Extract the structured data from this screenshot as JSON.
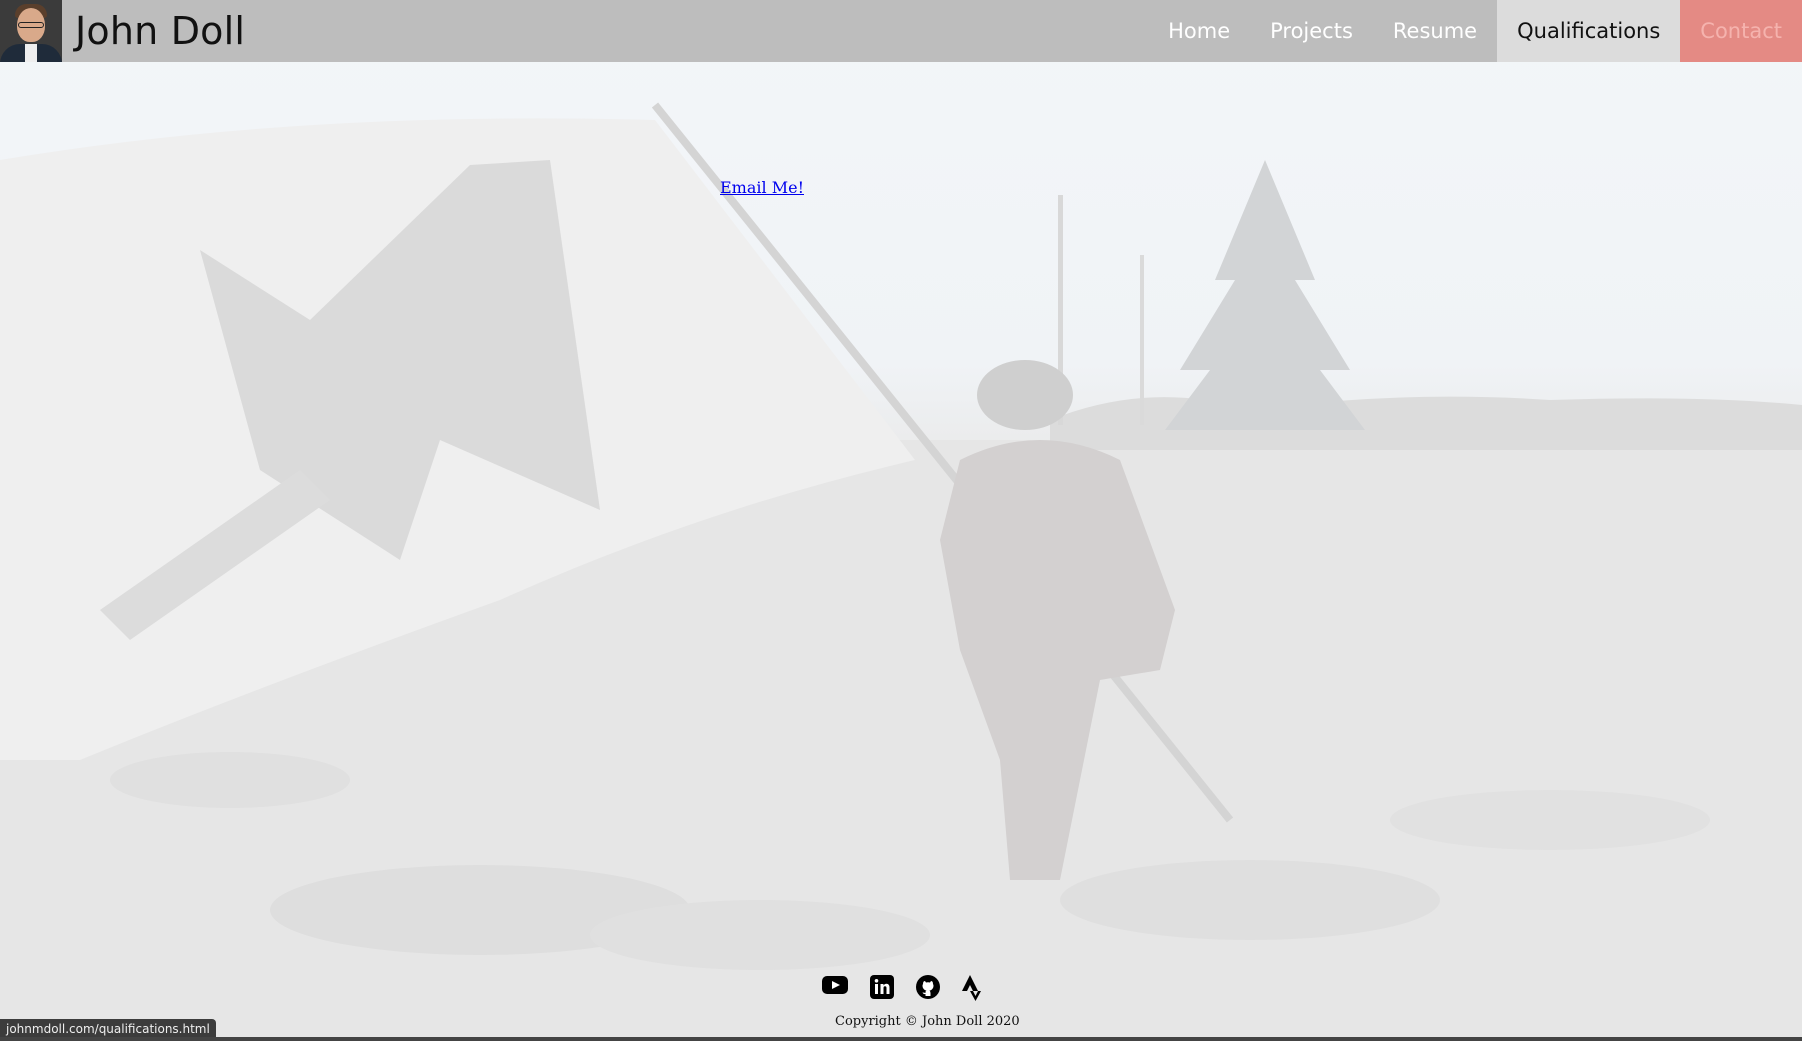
{
  "header": {
    "brand_name": "John Doll",
    "nav": [
      {
        "label": "Home"
      },
      {
        "label": "Projects"
      },
      {
        "label": "Resume"
      },
      {
        "label": "Qualifications"
      },
      {
        "label": "Contact"
      }
    ],
    "active_tab": "Qualifications"
  },
  "main": {
    "email_link": "Email Me!"
  },
  "footer": {
    "social_icons": [
      "youtube-icon",
      "linkedin-icon",
      "github-icon",
      "strava-icon"
    ],
    "copyright": "Copyright © John Doll 2020"
  },
  "status": {
    "hover_url": "johnmdoll.com/qualifications.html"
  },
  "colors": {
    "navbar": "#bdbdbd",
    "active_tab": "#dcdcdc",
    "contact_tab": "#e48a84",
    "link": "#0000ee"
  }
}
